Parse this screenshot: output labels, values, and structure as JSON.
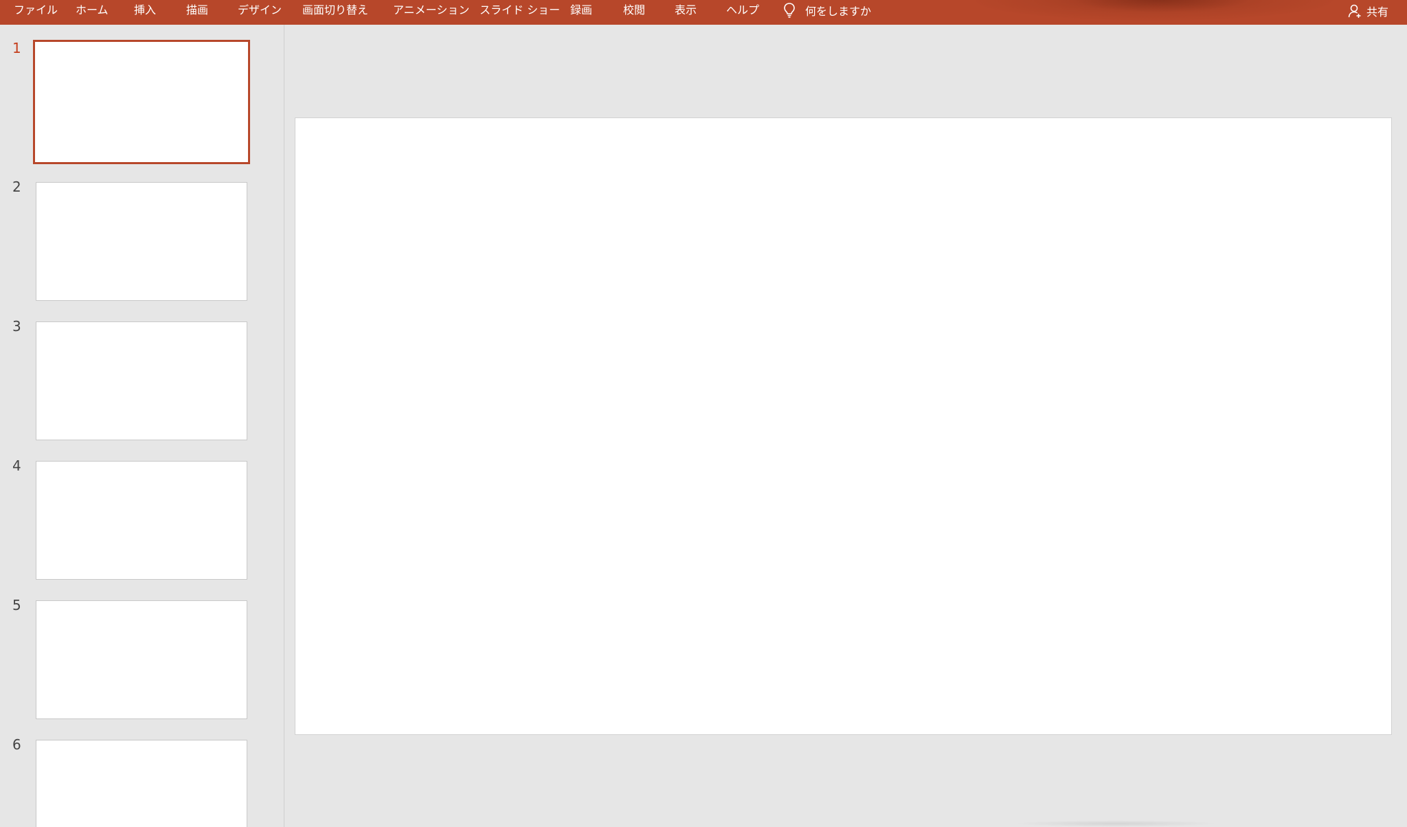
{
  "ribbon": {
    "tabs": [
      {
        "id": "file",
        "label": "ファイル"
      },
      {
        "id": "home",
        "label": "ホーム"
      },
      {
        "id": "insert",
        "label": "挿入"
      },
      {
        "id": "draw",
        "label": "描画"
      },
      {
        "id": "design",
        "label": "デザイン"
      },
      {
        "id": "transitions",
        "label": "画面切り替え"
      },
      {
        "id": "animations",
        "label": "アニメーション"
      },
      {
        "id": "slideshow",
        "label": "スライド ショー"
      },
      {
        "id": "record",
        "label": "録画"
      },
      {
        "id": "review",
        "label": "校閲"
      },
      {
        "id": "view",
        "label": "表示"
      },
      {
        "id": "help",
        "label": "ヘルプ"
      }
    ],
    "tell_me": {
      "label": "何をしますか",
      "icon": "lightbulb-icon"
    },
    "share": {
      "label": "共有",
      "icon": "person-icon"
    },
    "color": "#b7472a"
  },
  "thumbnails": {
    "selected": 1,
    "items": [
      {
        "number": "1"
      },
      {
        "number": "2"
      },
      {
        "number": "3"
      },
      {
        "number": "4"
      },
      {
        "number": "5"
      },
      {
        "number": "6"
      }
    ]
  }
}
